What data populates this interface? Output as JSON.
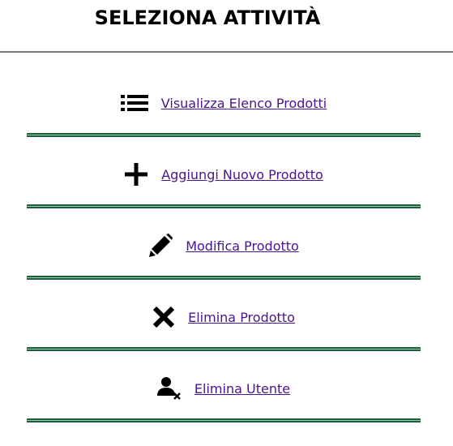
{
  "header": {
    "title": "SELEZIONA ATTIVITÀ"
  },
  "menu": {
    "items": [
      {
        "label": "Visualizza Elenco Prodotti",
        "icon": "list-icon"
      },
      {
        "label": "Aggiungi Nuovo Prodotto",
        "icon": "plus-icon"
      },
      {
        "label": "Modifica Prodotto",
        "icon": "pencil-icon"
      },
      {
        "label": "Elimina Prodotto",
        "icon": "close-icon"
      },
      {
        "label": "Elimina Utente",
        "icon": "user-remove-icon"
      }
    ]
  },
  "colors": {
    "link": "#4a148c",
    "separator": "#1b5e3a"
  }
}
